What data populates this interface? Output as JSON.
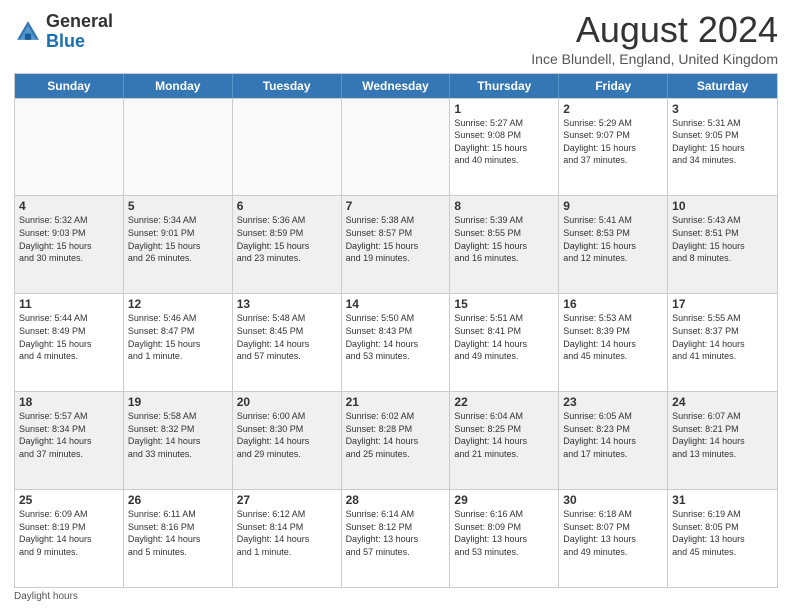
{
  "logo": {
    "general": "General",
    "blue": "Blue"
  },
  "title": "August 2024",
  "subtitle": "Ince Blundell, England, United Kingdom",
  "days": [
    "Sunday",
    "Monday",
    "Tuesday",
    "Wednesday",
    "Thursday",
    "Friday",
    "Saturday"
  ],
  "footer": "Daylight hours",
  "weeks": [
    [
      {
        "day": "",
        "info": ""
      },
      {
        "day": "",
        "info": ""
      },
      {
        "day": "",
        "info": ""
      },
      {
        "day": "",
        "info": ""
      },
      {
        "day": "1",
        "info": "Sunrise: 5:27 AM\nSunset: 9:08 PM\nDaylight: 15 hours\nand 40 minutes."
      },
      {
        "day": "2",
        "info": "Sunrise: 5:29 AM\nSunset: 9:07 PM\nDaylight: 15 hours\nand 37 minutes."
      },
      {
        "day": "3",
        "info": "Sunrise: 5:31 AM\nSunset: 9:05 PM\nDaylight: 15 hours\nand 34 minutes."
      }
    ],
    [
      {
        "day": "4",
        "info": "Sunrise: 5:32 AM\nSunset: 9:03 PM\nDaylight: 15 hours\nand 30 minutes."
      },
      {
        "day": "5",
        "info": "Sunrise: 5:34 AM\nSunset: 9:01 PM\nDaylight: 15 hours\nand 26 minutes."
      },
      {
        "day": "6",
        "info": "Sunrise: 5:36 AM\nSunset: 8:59 PM\nDaylight: 15 hours\nand 23 minutes."
      },
      {
        "day": "7",
        "info": "Sunrise: 5:38 AM\nSunset: 8:57 PM\nDaylight: 15 hours\nand 19 minutes."
      },
      {
        "day": "8",
        "info": "Sunrise: 5:39 AM\nSunset: 8:55 PM\nDaylight: 15 hours\nand 16 minutes."
      },
      {
        "day": "9",
        "info": "Sunrise: 5:41 AM\nSunset: 8:53 PM\nDaylight: 15 hours\nand 12 minutes."
      },
      {
        "day": "10",
        "info": "Sunrise: 5:43 AM\nSunset: 8:51 PM\nDaylight: 15 hours\nand 8 minutes."
      }
    ],
    [
      {
        "day": "11",
        "info": "Sunrise: 5:44 AM\nSunset: 8:49 PM\nDaylight: 15 hours\nand 4 minutes."
      },
      {
        "day": "12",
        "info": "Sunrise: 5:46 AM\nSunset: 8:47 PM\nDaylight: 15 hours\nand 1 minute."
      },
      {
        "day": "13",
        "info": "Sunrise: 5:48 AM\nSunset: 8:45 PM\nDaylight: 14 hours\nand 57 minutes."
      },
      {
        "day": "14",
        "info": "Sunrise: 5:50 AM\nSunset: 8:43 PM\nDaylight: 14 hours\nand 53 minutes."
      },
      {
        "day": "15",
        "info": "Sunrise: 5:51 AM\nSunset: 8:41 PM\nDaylight: 14 hours\nand 49 minutes."
      },
      {
        "day": "16",
        "info": "Sunrise: 5:53 AM\nSunset: 8:39 PM\nDaylight: 14 hours\nand 45 minutes."
      },
      {
        "day": "17",
        "info": "Sunrise: 5:55 AM\nSunset: 8:37 PM\nDaylight: 14 hours\nand 41 minutes."
      }
    ],
    [
      {
        "day": "18",
        "info": "Sunrise: 5:57 AM\nSunset: 8:34 PM\nDaylight: 14 hours\nand 37 minutes."
      },
      {
        "day": "19",
        "info": "Sunrise: 5:58 AM\nSunset: 8:32 PM\nDaylight: 14 hours\nand 33 minutes."
      },
      {
        "day": "20",
        "info": "Sunrise: 6:00 AM\nSunset: 8:30 PM\nDaylight: 14 hours\nand 29 minutes."
      },
      {
        "day": "21",
        "info": "Sunrise: 6:02 AM\nSunset: 8:28 PM\nDaylight: 14 hours\nand 25 minutes."
      },
      {
        "day": "22",
        "info": "Sunrise: 6:04 AM\nSunset: 8:25 PM\nDaylight: 14 hours\nand 21 minutes."
      },
      {
        "day": "23",
        "info": "Sunrise: 6:05 AM\nSunset: 8:23 PM\nDaylight: 14 hours\nand 17 minutes."
      },
      {
        "day": "24",
        "info": "Sunrise: 6:07 AM\nSunset: 8:21 PM\nDaylight: 14 hours\nand 13 minutes."
      }
    ],
    [
      {
        "day": "25",
        "info": "Sunrise: 6:09 AM\nSunset: 8:19 PM\nDaylight: 14 hours\nand 9 minutes."
      },
      {
        "day": "26",
        "info": "Sunrise: 6:11 AM\nSunset: 8:16 PM\nDaylight: 14 hours\nand 5 minutes."
      },
      {
        "day": "27",
        "info": "Sunrise: 6:12 AM\nSunset: 8:14 PM\nDaylight: 14 hours\nand 1 minute."
      },
      {
        "day": "28",
        "info": "Sunrise: 6:14 AM\nSunset: 8:12 PM\nDaylight: 13 hours\nand 57 minutes."
      },
      {
        "day": "29",
        "info": "Sunrise: 6:16 AM\nSunset: 8:09 PM\nDaylight: 13 hours\nand 53 minutes."
      },
      {
        "day": "30",
        "info": "Sunrise: 6:18 AM\nSunset: 8:07 PM\nDaylight: 13 hours\nand 49 minutes."
      },
      {
        "day": "31",
        "info": "Sunrise: 6:19 AM\nSunset: 8:05 PM\nDaylight: 13 hours\nand 45 minutes."
      }
    ]
  ]
}
